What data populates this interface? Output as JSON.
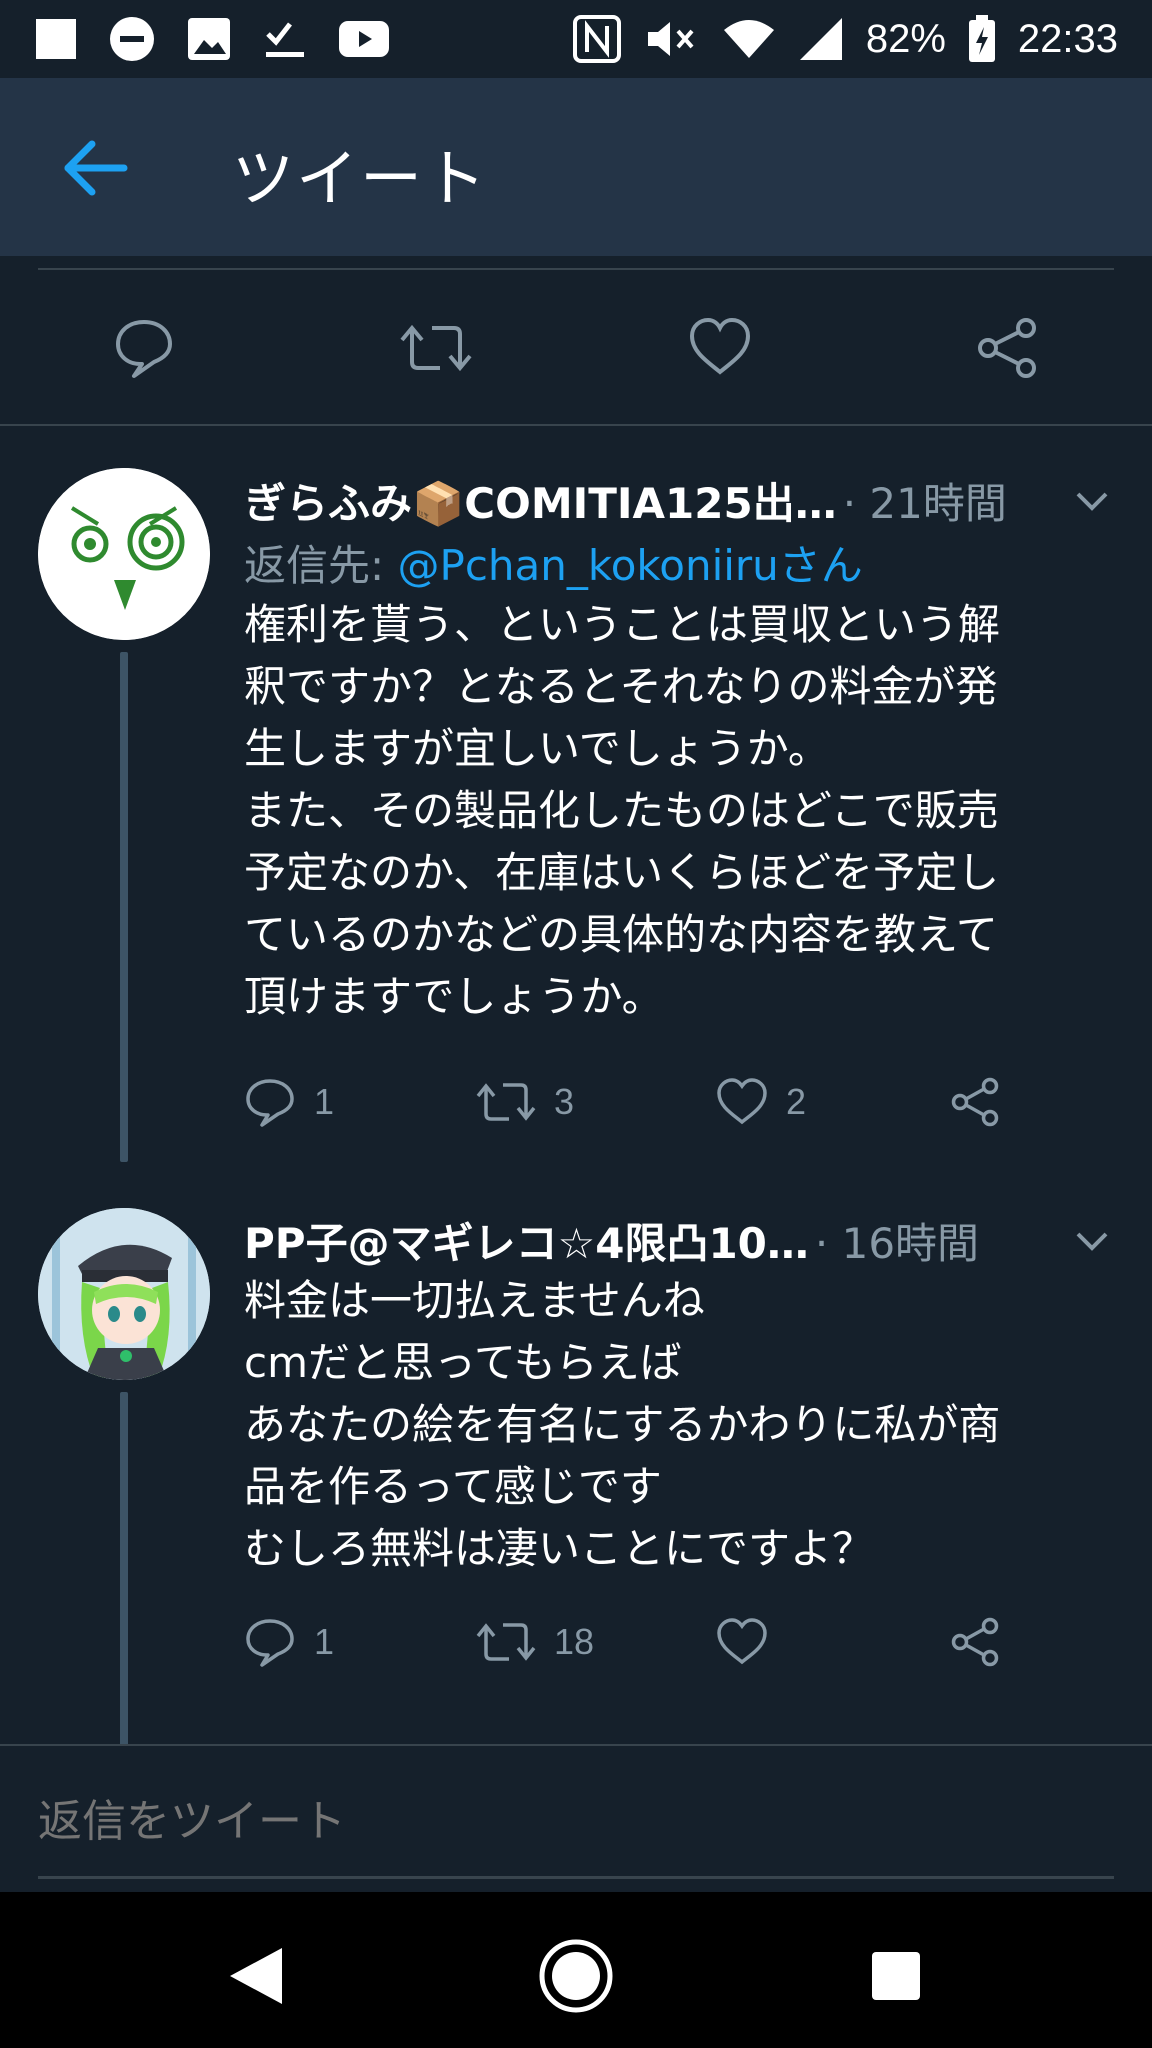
{
  "status_bar": {
    "battery": "82%",
    "time": "22:33",
    "left_icons": [
      "square-notification-icon",
      "do-not-disturb-icon",
      "image-icon",
      "checklist-icon",
      "youtube-icon"
    ],
    "right_icons": [
      "nfc-icon",
      "mute-icon",
      "wifi-icon",
      "signal-icon",
      "battery-charging-icon"
    ]
  },
  "app_bar": {
    "title": "ツイート"
  },
  "tweets": [
    {
      "author": "ぎらふみ📦COMITIA125出…",
      "meta": "· 21時間",
      "reply_prefix": "返信先: ",
      "reply_mention": "@Pchan_kokoniiruさん",
      "lines": [
        "権利を貰う、ということは買収という解",
        "釈ですか？となるとそれなりの料金が発",
        "生しますが宜しいでしょうか。",
        "また、その製品化したものはどこで販売",
        "予定なのか、在庫はいくらほどを予定し",
        "ているのかなどの具体的な内容を教えて",
        "頂けますでしょうか。"
      ],
      "reply_count": "1",
      "retweet_count": "3",
      "like_count": "2"
    },
    {
      "author": "PP子@マギレコ☆4限凸10…",
      "meta": "· 16時間",
      "lines": [
        "料金は一切払えませんね",
        "cmだと思ってもらえば",
        "あなたの絵を有名にするかわりに私が商",
        "品を作るって感じです",
        "むしろ無料は凄いことにですよ？"
      ],
      "reply_count": "1",
      "retweet_count": "18",
      "like_count": ""
    }
  ],
  "reply_box": {
    "placeholder": "返信をツイート"
  },
  "colors": {
    "background": "#15202b",
    "app_bar": "#243447",
    "accent": "#1da1f2",
    "secondary_text": "#8899a6",
    "divider": "#38444d"
  }
}
